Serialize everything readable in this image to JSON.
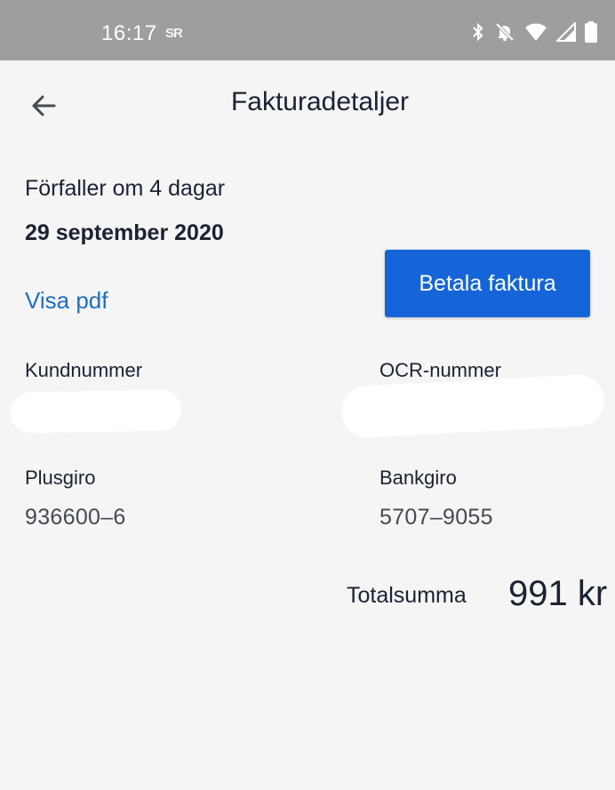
{
  "status_bar": {
    "time": "16:17",
    "notification_text": "SR",
    "icons": [
      "bluetooth-icon",
      "mute-bell-icon",
      "wifi-icon",
      "signal-icon",
      "battery-icon"
    ]
  },
  "app_bar": {
    "back_icon": "arrow-left-icon",
    "title": "Fakturadetaljer"
  },
  "invoice": {
    "due_text": "Förfaller om 4 dagar",
    "due_date": "29 september 2020",
    "pdf_link": "Visa pdf",
    "pay_button": "Betala faktura",
    "fields": {
      "customer_number_label": "Kundnummer",
      "ocr_number_label": "OCR-nummer",
      "plusgiro_label": "Plusgiro",
      "plusgiro_value": "936600–6",
      "bankgiro_label": "Bankgiro",
      "bankgiro_value": "5707–9055"
    },
    "total_label": "Totalsumma",
    "total_value": "991 kr"
  },
  "colors": {
    "status_bar": "#9e9e9e",
    "background": "#f5f5f5",
    "primary": "#1565d8",
    "link": "#1f6fbf",
    "text": "#1a2233"
  }
}
